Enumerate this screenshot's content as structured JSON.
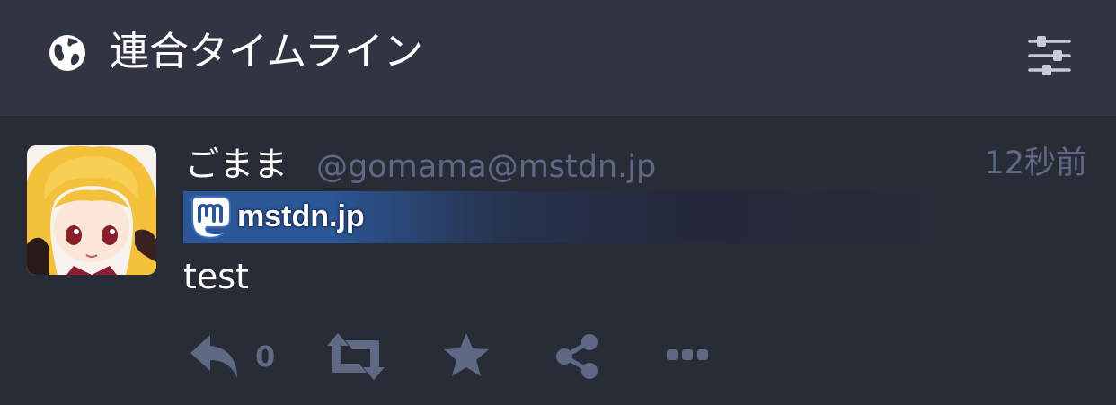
{
  "header": {
    "title": "連合タイムライン",
    "title_icon": "globe-icon",
    "settings_icon": "sliders-icon"
  },
  "status": {
    "display_name": "ごまま",
    "acct": "@gomama@mstdn.jp",
    "time": "12秒前",
    "ticker": {
      "icon": "mastodon-icon",
      "label": "mstdn.jp",
      "color": "#2b5797"
    },
    "content": "test",
    "actions": {
      "reply_icon": "reply-icon",
      "reply_count": "0",
      "boost_icon": "boost-icon",
      "favourite_icon": "star-icon",
      "share_icon": "share-icon",
      "more_icon": "ellipsis-icon"
    }
  },
  "colors": {
    "background": "#282c37",
    "header": "#313543",
    "muted": "#606984",
    "text": "#ffffff"
  }
}
